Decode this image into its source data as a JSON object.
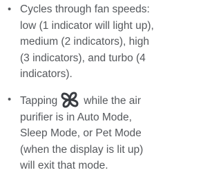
{
  "bullet_glyph": "•",
  "items": [
    {
      "lines": [
        "Cycles through fan speeds:",
        "low (1 indicator will light up),",
        "medium (2 indicators), high",
        "(3 indicators), and turbo (4",
        "indicators)."
      ]
    },
    {
      "line1_before_icon": "Tapping",
      "icon": "fan-icon",
      "line1_after_icon": "while the air",
      "lines": [
        "purifier is in Auto Mode,",
        "Sleep Mode, or Pet Mode",
        "(when the display is lit up)",
        "will exit that mode."
      ]
    }
  ],
  "colors": {
    "text": "#55585c",
    "icon": "#3a3d42"
  }
}
